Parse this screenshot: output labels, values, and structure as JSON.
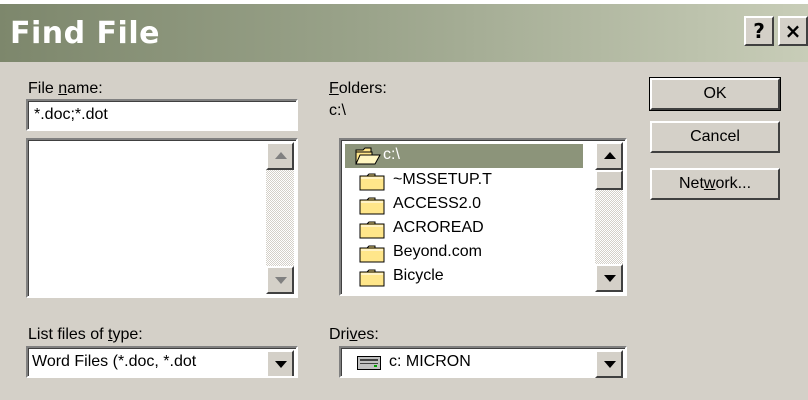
{
  "dialog": {
    "title": "Find File",
    "help_glyph": "?",
    "close_glyph": "×"
  },
  "file_name": {
    "label_pre": "File ",
    "label_key": "n",
    "label_post": "ame:",
    "value": "*.doc;*.dot"
  },
  "folders": {
    "label_key": "F",
    "label_post": "olders:",
    "current_path": "c:\\",
    "items": [
      {
        "name": "c:\\",
        "icon": "open-folder-icon"
      },
      {
        "name": "~MSSETUP.T",
        "icon": "folder-icon"
      },
      {
        "name": "ACCESS2.0",
        "icon": "folder-icon"
      },
      {
        "name": "ACROREAD",
        "icon": "folder-icon"
      },
      {
        "name": "Beyond.com",
        "icon": "folder-icon"
      },
      {
        "name": "Bicycle",
        "icon": "folder-icon"
      }
    ]
  },
  "list_type": {
    "label_pre": "List files of ",
    "label_key": "t",
    "label_post": "ype:",
    "value": "Word Files (*.doc, *.dot"
  },
  "drives": {
    "label_pre": "Dri",
    "label_key": "v",
    "label_post": "es:",
    "value": "c: MICRON",
    "icon": "drive-icon"
  },
  "buttons": {
    "ok": "OK",
    "cancel": "Cancel",
    "network_pre": "Net",
    "network_key": "w",
    "network_post": "ork..."
  },
  "colors": {
    "face": "#d4d0c8",
    "title_gradient_start": "#7d876c",
    "selection": "#8c947a",
    "folder_fill": "#ffe68a"
  }
}
